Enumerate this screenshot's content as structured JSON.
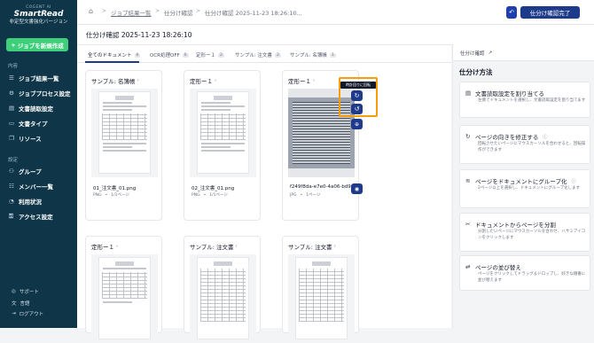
{
  "brand": {
    "line1": "COGENT AI",
    "line2": "SmartRead",
    "line3": "非定型文書強化バージョン"
  },
  "sidebar": {
    "new_job": "ジョブを新規作成",
    "section_main": "内容",
    "items": [
      {
        "label": "ジョブ結果一覧",
        "icon": "list-icon"
      },
      {
        "label": "ジョブプロセス設定",
        "icon": "process-icon"
      },
      {
        "label": "文書読取設定",
        "icon": "document-icon"
      },
      {
        "label": "文書タイプ",
        "icon": "doctype-icon"
      },
      {
        "label": "リソース",
        "icon": "resource-icon"
      }
    ],
    "section_settings": "設定",
    "settings": [
      {
        "label": "グループ",
        "icon": "group-icon"
      },
      {
        "label": "メンバー一覧",
        "icon": "members-icon"
      },
      {
        "label": "利用状況",
        "icon": "usage-icon"
      },
      {
        "label": "アクセス設定",
        "icon": "access-icon"
      }
    ],
    "footer": [
      {
        "label": "サポート",
        "icon": "support-icon"
      },
      {
        "label": "言語",
        "icon": "language-icon"
      },
      {
        "label": "ログアウト",
        "icon": "logout-icon"
      }
    ]
  },
  "breadcrumb": {
    "home_icon": "home-icon",
    "c1": "ジョブ結果一覧",
    "c2": "仕分け確認",
    "c3": "仕分け確認 2025-11-23 18:26:10..."
  },
  "header": {
    "undo_icon": "undo-icon",
    "confirm": "仕分け確認完了"
  },
  "page_title": "仕分け確認 2025-11-23 18:26:10",
  "tabs": [
    {
      "label": "全てのドキュメント",
      "count": "6"
    },
    {
      "label": "OCR処理OFF",
      "count": "0"
    },
    {
      "label": "定形ー１",
      "count": "2"
    },
    {
      "label": "サンプル: 注文書",
      "count": "2"
    },
    {
      "label": "サンプル: 名簿帳",
      "count": "1"
    }
  ],
  "cards": [
    {
      "title": "サンプル: 名簿帳",
      "count": "1",
      "file": "01_注文書_01.png",
      "type": "PNG",
      "pages": "1/1ページ"
    },
    {
      "title": "定形ー１",
      "count": "1",
      "file": "02_注文書_01.png",
      "type": "PNG",
      "pages": "1/1ページ"
    },
    {
      "title": "定形ー１",
      "count": "1",
      "file": "f249f8da-e7e0-4a06-bd94-c6...",
      "type": "JPG",
      "pages": "1ページ"
    },
    {
      "title": "定形ー１",
      "count": "1"
    },
    {
      "title": "サンプル: 注文書",
      "count": "1"
    },
    {
      "title": "サンプル: 注文書",
      "count": "1"
    }
  ],
  "tooltip": "時計回りに回転",
  "right_panel": {
    "tab": "仕分け確認",
    "title": "仕分け方法",
    "helps": [
      {
        "icon": "document-settings-icon",
        "title": "文書読取設定を割り当てる",
        "desc": "左側でドキュメントを選択し、文書読取設定を割り当てます"
      },
      {
        "icon": "rotate-icon",
        "title": "ページの向きを修正する",
        "desc": "回転させたいページにマウスカーソルを合わせると、回転操作ができます"
      },
      {
        "icon": "layers-icon",
        "title": "ページをドキュメントにグループ化",
        "desc": "2ページ以上を選択し、ドキュメントにグループ化します"
      },
      {
        "icon": "split-icon",
        "title": "ドキュメントからページを分割",
        "desc": "分割したいページにマウスカーソルを合わせ、ハサミアイコンをクリックします"
      },
      {
        "icon": "sort-icon",
        "title": "ページの並び替え",
        "desc": "ページをクリックしてドラッグ＆ドロップし、好きな順番に並び替えます"
      }
    ]
  }
}
